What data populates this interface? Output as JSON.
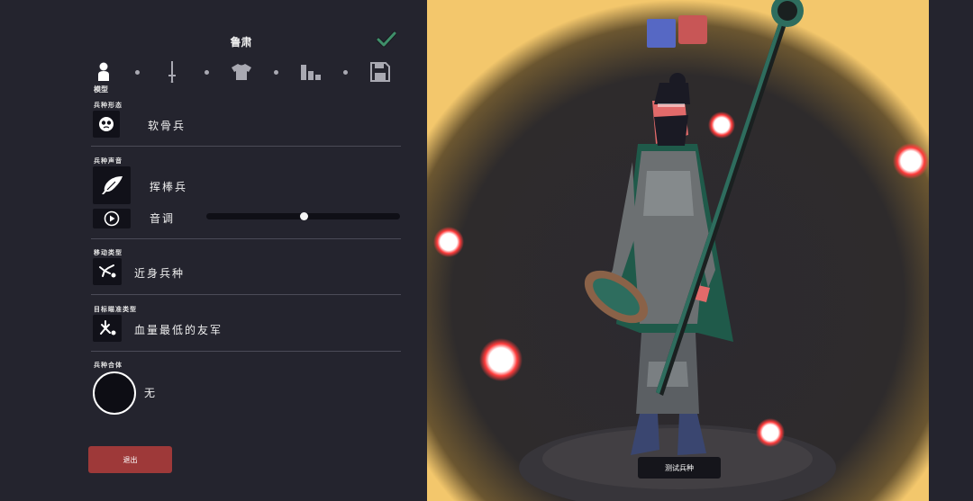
{
  "header": {
    "title": "鲁肃"
  },
  "tabs": [
    {
      "name": "model",
      "label": "模型",
      "active": true
    },
    {
      "name": "weapon",
      "active": false
    },
    {
      "name": "clothing",
      "active": false
    },
    {
      "name": "abilities",
      "active": false
    },
    {
      "name": "save",
      "active": false
    }
  ],
  "sections": {
    "body_type": {
      "label": "兵种形态",
      "value": "软骨兵"
    },
    "voice": {
      "label": "兵种声音",
      "value": "挥棒兵",
      "pitch_label": "音调",
      "pitch_value": 0.5
    },
    "movement": {
      "label": "移动类型",
      "value": "近身兵种"
    },
    "targeting": {
      "label": "目标瞄准类型",
      "value": "血量最低的友军"
    },
    "combo": {
      "label": "兵种合体",
      "value": "无"
    }
  },
  "buttons": {
    "exit": "退出",
    "test": "测试兵种"
  },
  "team_colors": {
    "blue": "#5668c4",
    "red": "#c85656"
  },
  "accent_colors": {
    "exit": "#9e3939",
    "check": "#3f8f6a"
  }
}
